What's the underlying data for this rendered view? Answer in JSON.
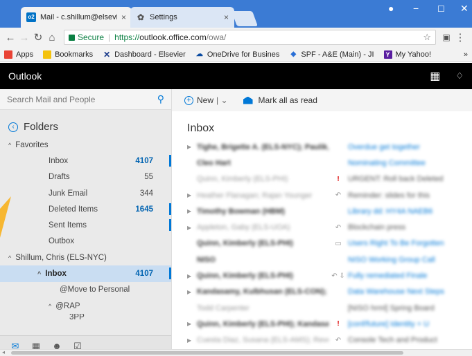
{
  "browser": {
    "tabs": [
      {
        "title": "Mail - c.shillum@elsevier",
        "favicon": "o2",
        "close": "×",
        "active": true
      },
      {
        "title": "Settings",
        "favicon": "gear-icon",
        "close": "×",
        "active": false
      }
    ],
    "secure_label": "Secure",
    "url_scheme": "https://",
    "url_host": "outlook.office.com",
    "url_path": "/owa/",
    "bookmarks": [
      "Apps",
      "Bookmarks",
      "Dashboard - Elsevier",
      "OneDrive for Busines",
      "SPF - A&E (Main) - JI",
      "My Yahoo!"
    ],
    "overflow": "»"
  },
  "outlook": {
    "brand": "Outlook",
    "search_placeholder": "Search Mail and People",
    "folders_title": "Folders",
    "favorites_label": "Favorites",
    "favorites": [
      {
        "label": "Inbox",
        "count": "4107",
        "highlight": true
      },
      {
        "label": "Drafts",
        "count": "55",
        "highlight": false
      },
      {
        "label": "Junk Email",
        "count": "344",
        "highlight": false
      },
      {
        "label": "Deleted Items",
        "count": "1645",
        "highlight": true
      },
      {
        "label": "Sent Items",
        "count": "",
        "highlight": false
      },
      {
        "label": "Outbox",
        "count": "",
        "highlight": false
      }
    ],
    "account_label": "Shillum, Chris (ELS-NYC)",
    "account_inbox": {
      "label": "Inbox",
      "count": "4107"
    },
    "subfolders": [
      "@Move to Personal",
      "@RAP",
      "3PP"
    ],
    "commands": {
      "new": "New",
      "mark_all_read": "Mark all as read"
    },
    "list_title": "Inbox"
  },
  "messages": [
    {
      "from": "Tighe, Brigette A. (ELS-NYC); Paulik, Josef (E)",
      "subject": "Overdue get together",
      "icon": "",
      "bold": true,
      "expand": true
    },
    {
      "from": "Cleo Hart",
      "subject": "Nominating Committee",
      "icon": "",
      "bold": true,
      "expand": false
    },
    {
      "from": "Quinn, Kimberly (ELS-PHI)",
      "subject": "URGENT: Roll back Deleted",
      "icon": "!",
      "bold": false,
      "expand": false
    },
    {
      "from": "Heather Flanagan; Rajan Younger",
      "subject": "Reminder: slides for this",
      "icon": "reply",
      "bold": false,
      "expand": true
    },
    {
      "from": "Timothy Bowman (HBM)",
      "subject": "Library dd: HY4A NAEB6",
      "icon": "",
      "bold": true,
      "expand": true
    },
    {
      "from": "Appleton, Gaby (ELS-UOA)",
      "subject": "Blockchain press",
      "icon": "reply",
      "bold": false,
      "expand": true
    },
    {
      "from": "Quinn, Kimberly (ELS-PHI)",
      "subject": "Users Right To Be Forgotten",
      "icon": "cal",
      "bold": true,
      "expand": false
    },
    {
      "from": "NISO",
      "subject": "NISO Working Group Call",
      "icon": "",
      "bold": true,
      "expand": false
    },
    {
      "from": "Quinn, Kimberly (ELS-PHI)",
      "subject": "Fully remediated Finale",
      "icon": "reply2",
      "bold": true,
      "expand": true
    },
    {
      "from": "Kandasamy, Kulbhusan (ELS-CON); Quinn",
      "subject": "Data Warehouse Next Steps",
      "icon": "",
      "bold": true,
      "expand": true
    },
    {
      "from": "Todd Carpenter",
      "subject": "[NISO hrml] Spring Board",
      "icon": "",
      "bold": false,
      "expand": false
    },
    {
      "from": "Quinn, Kimberly (ELS-PHI); Kandasamy",
      "subject": "[conf/future] Identity + U",
      "icon": "!",
      "bold": true,
      "expand": true
    },
    {
      "from": "Cuesta Diaz, Susana (ELS-AMS); Revere Dan",
      "subject": "Console Tech and Product",
      "icon": "reply",
      "bold": false,
      "expand": true
    }
  ],
  "colors": {
    "chrome_blue": "#3b7bd4",
    "accent": "#0078d7",
    "header_bg": "#000000",
    "selected_bg": "#c9ddf2"
  }
}
